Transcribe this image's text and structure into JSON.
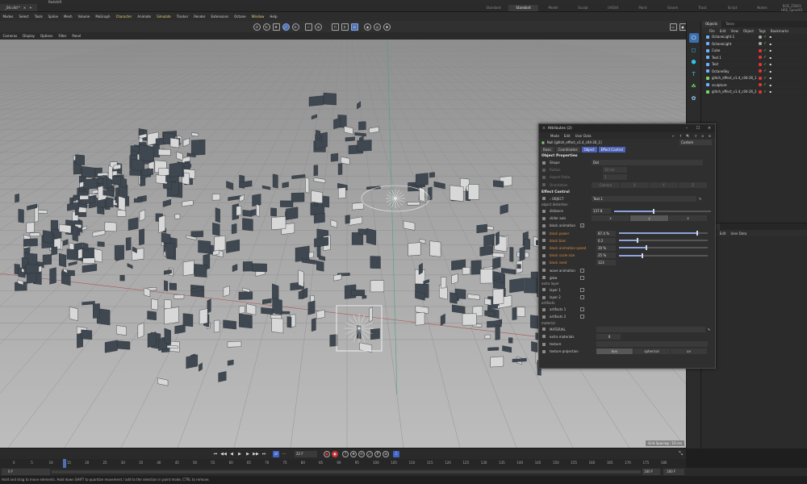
{
  "window": {
    "title": "Redshift",
    "file_tab": "_04.c4d *"
  },
  "layouts": [
    "Standard",
    "Standard",
    "Model",
    "Sculpt",
    "UVEdit",
    "Paint",
    "Groom",
    "Track",
    "Script",
    "Nodes",
    "BOE_ZSB01 HRE_Spout01"
  ],
  "menus": [
    "Modes",
    "Select",
    "Tools",
    "Spline",
    "Mesh",
    "Volume",
    "MoGraph",
    "Character",
    "Animate",
    "Simulate",
    "Tracker",
    "Render",
    "Extensions",
    "Octane",
    "Window",
    "Help"
  ],
  "highlight_menus": [
    "Character",
    "Simulate",
    "Window"
  ],
  "view_menu": [
    "Cameras",
    "Display",
    "Options",
    "Filter",
    "Panel"
  ],
  "objects_panel": {
    "tabs": [
      "Objects",
      "Takes"
    ],
    "menu": [
      "File",
      "Edit",
      "View",
      "Object",
      "Tags",
      "Bookmarks"
    ],
    "rows": [
      {
        "name": "OctaneLight.1",
        "color": "#6fb3ff"
      },
      {
        "name": "OctaneLight",
        "color": "#6fb3ff"
      },
      {
        "name": "Cube",
        "color": "#6fb3ff"
      },
      {
        "name": "Text.1",
        "color": "#6fb3ff"
      },
      {
        "name": "Text",
        "color": "#6fb3ff"
      },
      {
        "name": "OctaneSky",
        "color": "#6fb3ff"
      },
      {
        "name": "glitch_effect_v1.4_c04-26_1",
        "color": "#7bd46b"
      },
      {
        "name": "sculpture",
        "color": "#6fb3ff"
      },
      {
        "name": "glitch_effect_v1.4_c04-26_2",
        "color": "#7bd46b"
      }
    ]
  },
  "layers_panel": {
    "tabs": [
      "Layers"
    ],
    "menu": [
      "File",
      "Edit",
      "User Data"
    ]
  },
  "attributes": {
    "title": "Attributes (2)",
    "menu": [
      "Mode",
      "Edit",
      "User Data"
    ],
    "object": "Null [glitch_effect_v1.4_c04-26_1]",
    "preset": "Custom",
    "tabs": [
      "Basic",
      "Coordinates",
      "Object",
      "Effect Control"
    ],
    "object_properties": "Object Properties",
    "shape_label": "Shape",
    "shape_value": "Dot",
    "radius_label": "Radius",
    "radius_value": "10 cm",
    "aspect_label": "Aspect Ratio",
    "aspect_value": "1",
    "orientation_label": "Orientation",
    "orientation_value": "Camera",
    "orientation_opts": [
      "Camera",
      "X",
      "Y",
      "Z"
    ],
    "effect_control": "Effect Control",
    "object_label": "OBJECT",
    "object_value": "Text.1",
    "sub_distortion": "object distortion",
    "distance_label": "distance",
    "distance_value": "137.8",
    "distance_frac": 0.4,
    "slider_axis_label": "slider axis",
    "axes": [
      "x",
      "y",
      "z"
    ],
    "block_animation_label": "block animation",
    "params": [
      {
        "label": "block power",
        "value": "87.4 %",
        "frac": 0.874
      },
      {
        "label": "block bias",
        "value": "0.2",
        "frac": 0.2
      },
      {
        "label": "block animation speed",
        "value": "30 %",
        "frac": 0.3
      },
      {
        "label": "block scale size",
        "value": "25 %",
        "frac": 0.25
      },
      {
        "label": "block seed",
        "value": "123",
        "frac": null
      }
    ],
    "wave_animation": "wave animation",
    "glow": "glow",
    "sub_layer": "extra layer",
    "layer1": "layer 1",
    "layer2": "layer 2",
    "sub_artifacts": "artifacts",
    "artifacts1": "artifacts 1",
    "artifacts2": "artifacts 2",
    "sub_material": "material",
    "material_label": "MATERIAL",
    "extra_materials_label": "extra materials",
    "extra_materials_value": "0",
    "texture_label": "texture",
    "projection_label": "texture projection",
    "projection_opts": [
      "box",
      "spherical",
      "uv"
    ]
  },
  "viewport": {
    "status": "Grid Spacing : 10 cm"
  },
  "timeline": {
    "current_frame": "22 F",
    "ticks": [
      "0",
      "5",
      "10",
      "15",
      "20",
      "25",
      "30",
      "35",
      "40",
      "45",
      "50",
      "55",
      "60",
      "65",
      "70",
      "75",
      "80",
      "85",
      "90",
      "95",
      "100",
      "105",
      "110",
      "115",
      "120",
      "125",
      "130",
      "135",
      "140",
      "145",
      "150",
      "155",
      "160",
      "165",
      "170",
      "175",
      "180"
    ],
    "start": "0 F",
    "end": "180 F",
    "end2": "180 F"
  },
  "status_bar": "Hold and drag to move elements. Hold down SHIFT to quantize movement / add to the selection in point mode, CTRL to remove."
}
